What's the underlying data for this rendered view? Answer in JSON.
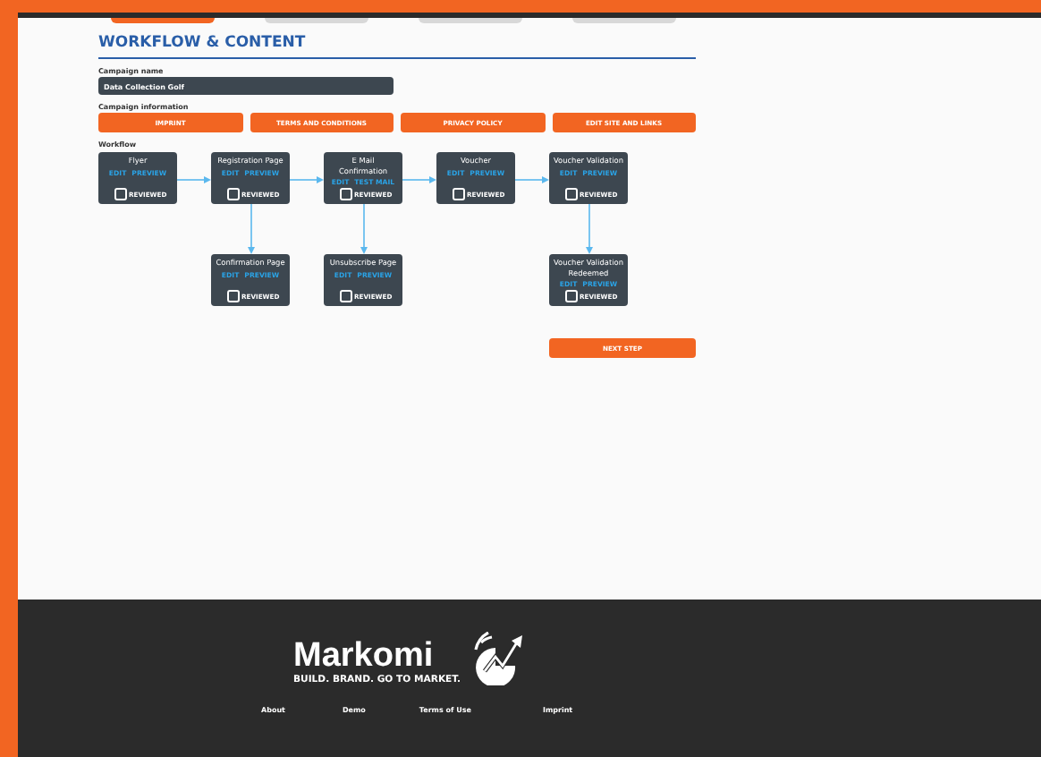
{
  "stepper": [
    {
      "selected": true
    },
    {
      "selected": false
    },
    {
      "selected": false
    },
    {
      "selected": false
    }
  ],
  "page_title": "WORKFLOW & CONTENT",
  "campaign_name": {
    "label": "Campaign name",
    "value": "Data Collection Golf"
  },
  "campaign_information": {
    "label": "Campaign information",
    "buttons": [
      "IMPRINT",
      "TERMS AND CONDITIONS",
      "PRIVACY POLICY",
      "EDIT SITE AND LINKS"
    ]
  },
  "workflow": {
    "label": "Workflow",
    "steps": [
      {
        "title": "Flyer",
        "links": [
          "EDIT",
          "PREVIEW"
        ],
        "reviewed": false,
        "reviewed_label": "REVIEWED"
      },
      {
        "title": "Registration Page",
        "links": [
          "EDIT",
          "PREVIEW"
        ],
        "reviewed": false,
        "reviewed_label": "REVIEWED",
        "branch": {
          "title": "Confirmation Page",
          "links": [
            "EDIT",
            "PREVIEW"
          ],
          "reviewed": false,
          "reviewed_label": "REVIEWED"
        }
      },
      {
        "title": "E Mail Confirmation",
        "links": [
          "EDIT",
          "TEST MAIL"
        ],
        "reviewed": false,
        "reviewed_label": "REVIEWED",
        "branch": {
          "title": "Unsubscribe Page",
          "links": [
            "EDIT",
            "PREVIEW"
          ],
          "reviewed": false,
          "reviewed_label": "REVIEWED"
        }
      },
      {
        "title": "Voucher",
        "links": [
          "EDIT",
          "PREVIEW"
        ],
        "reviewed": false,
        "reviewed_label": "REVIEWED"
      },
      {
        "title": "Voucher Validation",
        "links": [
          "EDIT",
          "PREVIEW"
        ],
        "reviewed": false,
        "reviewed_label": "REVIEWED",
        "branch": {
          "title": "Voucher Validation Redeemed",
          "links": [
            "EDIT",
            "PREVIEW"
          ],
          "reviewed": false,
          "reviewed_label": "REVIEWED"
        }
      }
    ]
  },
  "next_step": "NEXT STEP",
  "footer": {
    "brand": "Markomi",
    "tagline": "BUILD. BRAND. GO TO MARKET.",
    "links": [
      "About",
      "Demo",
      "Terms of Use",
      "Imprint"
    ]
  }
}
